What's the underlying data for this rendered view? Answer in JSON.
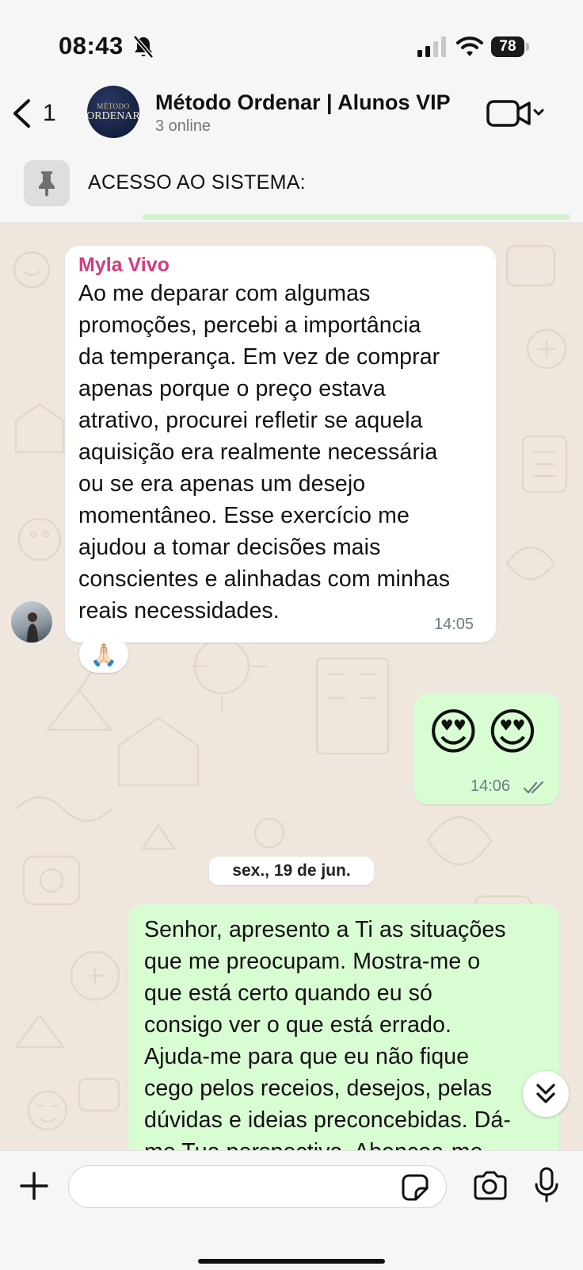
{
  "status_bar": {
    "time": "08:43",
    "battery": "78"
  },
  "header": {
    "back_count": "1",
    "group_name": "Método Ordenar | Alunos VIP",
    "group_status": "3 online",
    "avatar_line1": "MÉTODO",
    "avatar_line2": "ORDENAR"
  },
  "pinned": {
    "text": "ACESSO AO SISTEMA:"
  },
  "messages": [
    {
      "sender": "Myla Vivo",
      "lines": [
        "Ao me deparar com algumas",
        "promoções, percebi a importância",
        "da temperança. Em vez de comprar",
        "apenas porque o preço estava",
        "atrativo, procurei refletir se aquela",
        "aquisição era realmente necessária",
        "ou se era apenas um desejo",
        "momentâneo. Esse exercício me",
        "ajudou a tomar decisões mais",
        "conscientes e alinhadas com minhas",
        "reais necessidades."
      ],
      "time": "14:05",
      "reaction": "🙏🏻"
    },
    {
      "emojis": [
        "😍",
        "😍"
      ],
      "time": "14:06"
    },
    {
      "lines": [
        "Senhor, apresento a Ti as situações",
        "que me preocupam. Mostra-me o",
        "que está certo quando eu só",
        "consigo ver o que está errado.",
        "Ajuda-me para que eu não fique",
        "cego pelos receios, desejos, pelas",
        "dúvidas e ideias preconcebidas. Dá-",
        "me Tua perspectiva. Abençoa-me"
      ]
    }
  ],
  "date_separator": "sex., 19 de jun.",
  "icons": {
    "status": [
      "bell-slash-icon",
      "signal-icon",
      "wifi-icon",
      "battery-icon"
    ],
    "header": [
      "chevron-left-icon",
      "video-camera-icon",
      "chevron-down-icon",
      "pin-icon"
    ],
    "composer": [
      "plus-icon",
      "sticker-icon",
      "camera-icon",
      "microphone-icon"
    ],
    "other": [
      "double-chevron-down-icon",
      "double-check-icon"
    ]
  },
  "colors": {
    "sender_name": "#d63a7e",
    "outgoing_bubble": "#d9fdd3",
    "chat_background": "#efe7de"
  }
}
